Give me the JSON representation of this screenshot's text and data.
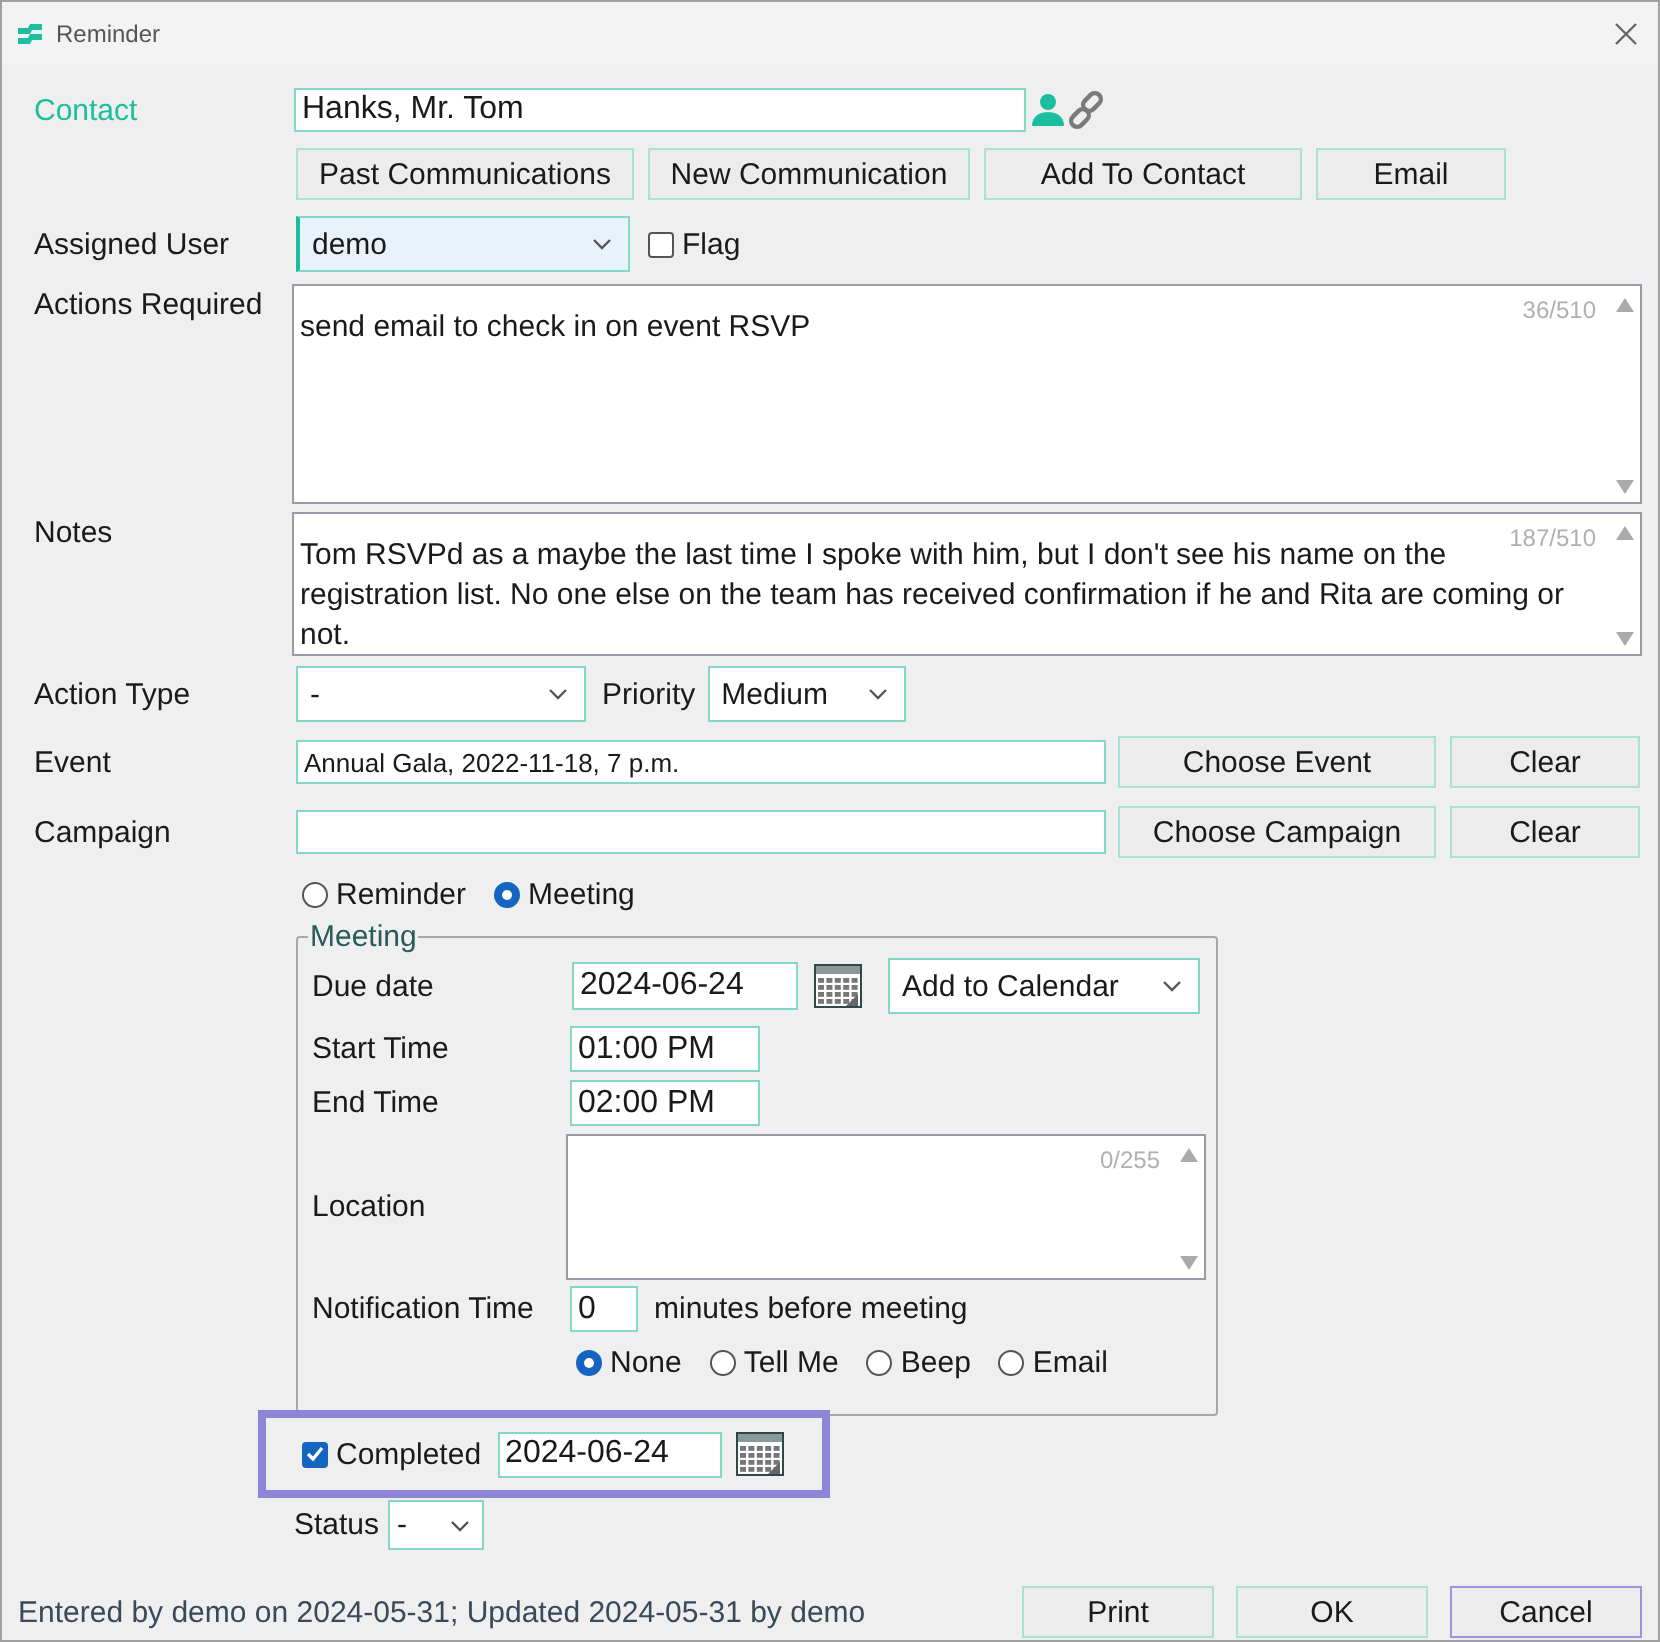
{
  "window": {
    "title": "Reminder"
  },
  "contact": {
    "label": "Contact",
    "value": "Hanks, Mr. Tom"
  },
  "contact_buttons": [
    "Past Communications",
    "New Communication",
    "Add To Contact",
    "Email"
  ],
  "assigned_user": {
    "label": "Assigned User",
    "value": "demo"
  },
  "flag": {
    "label": "Flag",
    "checked": false
  },
  "actions_required": {
    "label": "Actions Required",
    "value": "send email to check in on event RSVP",
    "counter": "36/510"
  },
  "notes": {
    "label": "Notes",
    "value": "Tom RSVPd as a maybe the last time I spoke with him, but I don't see his name on the registration list. No one else on the team has received confirmation if he and Rita are coming or not.",
    "counter": "187/510"
  },
  "action_type": {
    "label": "Action Type",
    "value": "-"
  },
  "priority": {
    "label": "Priority",
    "value": "Medium"
  },
  "event": {
    "label": "Event",
    "value": "Annual Gala, 2022-11-18, 7 p.m.",
    "buttons": [
      "Choose Event",
      "Clear"
    ]
  },
  "campaign": {
    "label": "Campaign",
    "buttons": [
      "Choose Campaign",
      "Clear"
    ]
  },
  "reminder_type": [
    {
      "label": "Reminder",
      "selected": false
    },
    {
      "label": "Meeting",
      "selected": true
    }
  ],
  "meeting": {
    "title": "Meeting",
    "due_date": {
      "label": "Due date",
      "value": "2024-06-24"
    },
    "calendar_dropdown": "Add to Calendar",
    "start_time": {
      "label": "Start Time",
      "value": "01:00 PM"
    },
    "end_time": {
      "label": "End Time",
      "value": "02:00 PM"
    },
    "location": {
      "label": "Location",
      "counter": "0/255"
    },
    "notification_time": {
      "label": "Notification Time",
      "value": "0",
      "suffix": "minutes before meeting"
    },
    "notification": [
      {
        "label": "None",
        "selected": true
      },
      {
        "label": "Tell Me",
        "selected": false
      },
      {
        "label": "Beep",
        "selected": false
      },
      {
        "label": "Email",
        "selected": false
      }
    ]
  },
  "completed": {
    "label": "Completed",
    "checked": true,
    "date": "2024-06-24"
  },
  "status": {
    "label": "Status",
    "value": "-"
  },
  "status_bar": "Entered by demo on 2024-05-31; Updated 2024-05-31 by demo",
  "buttons": [
    {
      "label": "Print",
      "focused": false
    },
    {
      "label": "OK",
      "focused": false
    },
    {
      "label": "Cancel",
      "focused": true
    }
  ]
}
